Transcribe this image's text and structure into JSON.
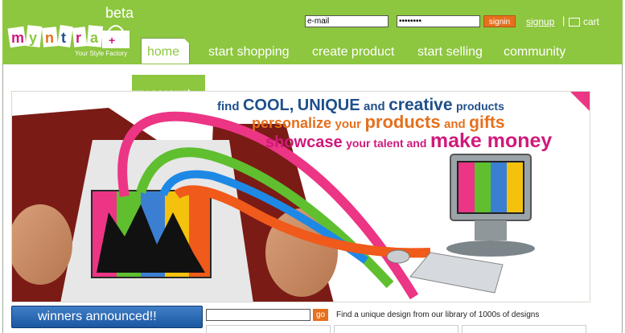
{
  "header": {
    "logo_text": "myntra",
    "beta": "beta",
    "tagline": "Your Style Factory",
    "email_placeholder": "e-mail",
    "password_value": "••••••••",
    "signin_label": "signin",
    "signup_label": "signup",
    "separator": "|",
    "cart_label": "cart"
  },
  "nav": {
    "home": "home",
    "items": [
      "start shopping",
      "create product",
      "start selling",
      "community"
    ],
    "my_account": "my account"
  },
  "banner": {
    "line1_parts": [
      "find",
      "COOL,",
      "UNIQUE",
      "and",
      "creative",
      "products"
    ],
    "line2_parts": [
      "personalize",
      "your",
      "products",
      "and",
      "gifts"
    ],
    "line3_parts": [
      "showcase",
      "your talent and",
      "make money"
    ]
  },
  "footer": {
    "winners_label": "winners announced!!",
    "search_placeholder": "",
    "go_label": "go",
    "find_text": "Find a unique design from our library of 1000s of designs"
  },
  "colors": {
    "header_green": "#8dc63f",
    "accent_orange": "#e5701d",
    "brand_blue": "#1f4f8a",
    "brand_pink": "#d0197c"
  }
}
